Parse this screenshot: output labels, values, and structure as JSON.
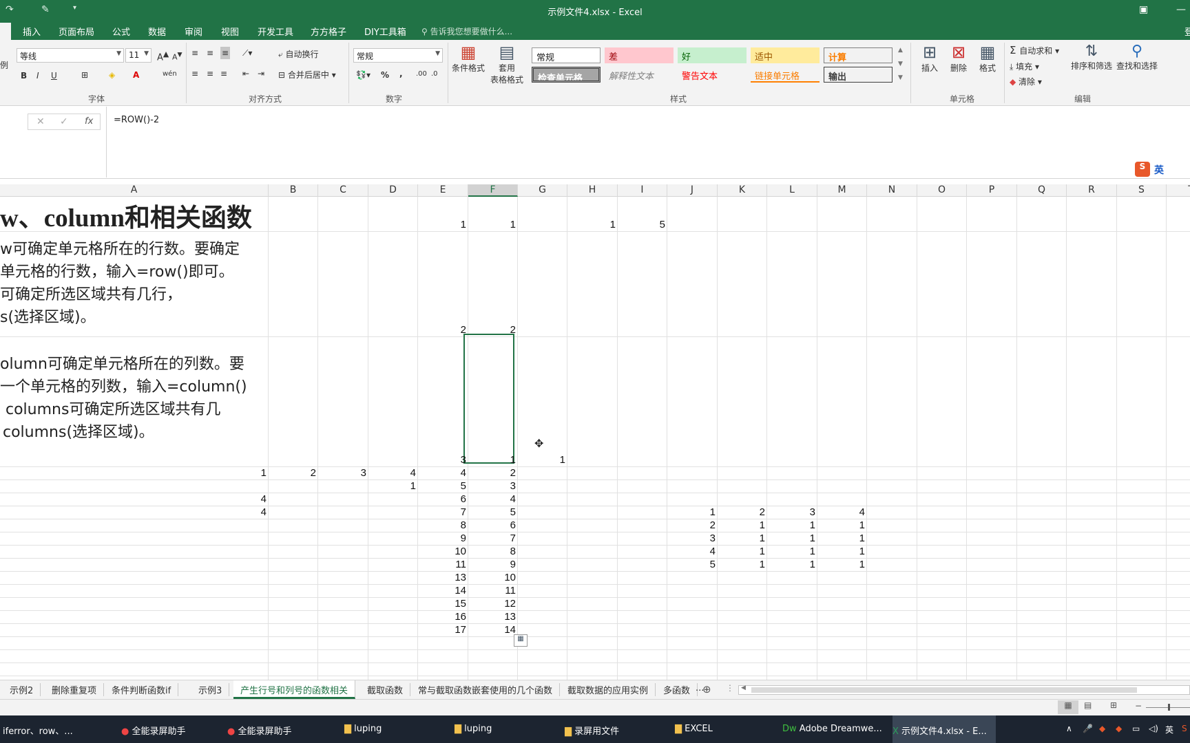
{
  "window": {
    "title": "示例文件4.xlsx - Excel"
  },
  "menu": {
    "tabs": [
      "插入",
      "页面布局",
      "公式",
      "数据",
      "审阅",
      "视图",
      "开发工具",
      "方方格子",
      "DIY工具箱"
    ],
    "tell_me": "告诉我您想要做什么...",
    "sign": "登"
  },
  "ribbon": {
    "font_name": "等线",
    "font_size": "11",
    "bold": "B",
    "italic": "I",
    "underline": "U",
    "font_group": "字体",
    "wrap_text": "自动换行",
    "merge_center": "合并后居中",
    "align_group": "对齐方式",
    "number_format": "常规",
    "percent": "%",
    "comma": ",",
    "number_group": "数字",
    "conditional_format": "条件格式",
    "table_format_1": "套用",
    "table_format_2": "表格格式",
    "styles": {
      "normal": "常规",
      "bad": "差",
      "good": "好",
      "neutral": "适中",
      "calculation": "计算",
      "check_cell": "检查单元格",
      "explanatory": "解释性文本",
      "warning": "警告文本",
      "linked_cell": "链接单元格",
      "output": "输出"
    },
    "styles_group": "样式",
    "insert": "插入",
    "delete": "删除",
    "format": "格式",
    "cells_group": "单元格",
    "autosum": "自动求和",
    "fill": "填充",
    "clear": "清除",
    "sort_filter": "排序和筛选",
    "find_select": "查找和选择",
    "editing_group": "编辑",
    "left_edge": "例"
  },
  "formula_bar": {
    "formula": "=ROW()-2",
    "ime": "英"
  },
  "columns": [
    "A",
    "B",
    "C",
    "D",
    "E",
    "F",
    "G",
    "H",
    "I",
    "J",
    "K",
    "L",
    "M",
    "N",
    "O",
    "P",
    "Q",
    "R",
    "S",
    "T"
  ],
  "selected_column": "F",
  "sheet": {
    "title": "w、column和相关函数",
    "desc1": [
      "w可确定单元格所在的行数。要确定",
      "单元格的行数，输入=row()即可。",
      "可确定所选区域共有几行，",
      "s(选择区域)。"
    ],
    "desc2": [
      "olumn可确定单元格所在的列数。要",
      "一个单元格的列数，输入=column()",
      "columns可确定所选区域共有几",
      "columns(选择区域)。"
    ],
    "row1": {
      "E": "1",
      "F": "1",
      "H": "1",
      "I": "5"
    },
    "row2": {
      "E": "2",
      "F": "2"
    },
    "row3": {
      "E": "3",
      "F": "1",
      "G": "1"
    },
    "table_rows": [
      {
        "A": "1",
        "B": "2",
        "C": "3",
        "D": "4",
        "E": "4",
        "F": "2"
      },
      {
        "D": "1",
        "E": "5",
        "F": "3"
      },
      {
        "A": "4",
        "E": "6",
        "F": "4"
      },
      {
        "A": "4",
        "E": "7",
        "F": "5",
        "J": "1",
        "K": "2",
        "L": "3",
        "M": "4"
      },
      {
        "E": "8",
        "F": "6",
        "J": "2",
        "K": "1",
        "L": "1",
        "M": "1"
      },
      {
        "E": "9",
        "F": "7",
        "J": "3",
        "K": "1",
        "L": "1",
        "M": "1"
      },
      {
        "E": "10",
        "F": "8",
        "J": "4",
        "K": "1",
        "L": "1",
        "M": "1"
      },
      {
        "E": "11",
        "F": "9",
        "J": "5",
        "K": "1",
        "L": "1",
        "M": "1"
      },
      {
        "E": "13",
        "F": "10"
      },
      {
        "E": "14",
        "F": "11"
      },
      {
        "E": "15",
        "F": "12"
      },
      {
        "E": "16",
        "F": "13"
      },
      {
        "E": "17",
        "F": "14"
      }
    ]
  },
  "sheet_tabs": [
    "示例2",
    "删除重复项",
    "条件判断函数if",
    "示例3",
    "产生行号和列号的函数相关",
    "截取函数",
    "常与截取函数嵌套使用的几个函数",
    "截取数据的应用实例",
    "多函数"
  ],
  "active_sheet_tab": "产生行号和列号的函数相关",
  "sheet_more": "...",
  "taskbar": {
    "items": [
      "iferror、row、...",
      "全能录屏助手",
      "全能录屏助手",
      "luping",
      "luping",
      "录屏用文件",
      "EXCEL",
      "Adobe Dreamwe...",
      "示例文件4.xlsx - E..."
    ],
    "tray": "英"
  },
  "colors": {
    "accent": "#217346",
    "bad_bg": "#ffc7ce",
    "good_bg": "#c6efce",
    "neutral_bg": "#ffeb9c"
  }
}
